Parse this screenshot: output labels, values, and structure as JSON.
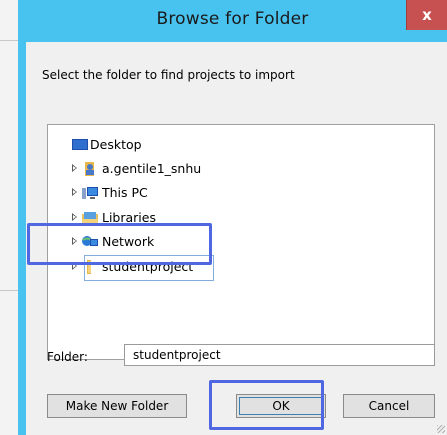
{
  "dialog": {
    "title": "Browse for Folder",
    "close_label": "x",
    "instruction": "Select the folder to find projects to import"
  },
  "tree": {
    "items": [
      {
        "label": "Desktop",
        "icon": "desktop-icon"
      },
      {
        "label": "a.gentile1_snhu",
        "icon": "user-folder-icon"
      },
      {
        "label": "This PC",
        "icon": "computer-icon"
      },
      {
        "label": "Libraries",
        "icon": "libraries-icon"
      },
      {
        "label": "Network",
        "icon": "network-icon"
      },
      {
        "label": "studentproject",
        "icon": "folder-icon",
        "selected": true
      }
    ]
  },
  "folder_field": {
    "label": "Folder:",
    "value": "studentproject"
  },
  "buttons": {
    "make_new_folder": "Make New Folder",
    "ok": "OK",
    "cancel": "Cancel"
  },
  "colors": {
    "title_bar": "#48c3f0",
    "close_button": "#c75050",
    "highlight_outline": "#4f67e0",
    "client_background": "#f0f0f0"
  }
}
